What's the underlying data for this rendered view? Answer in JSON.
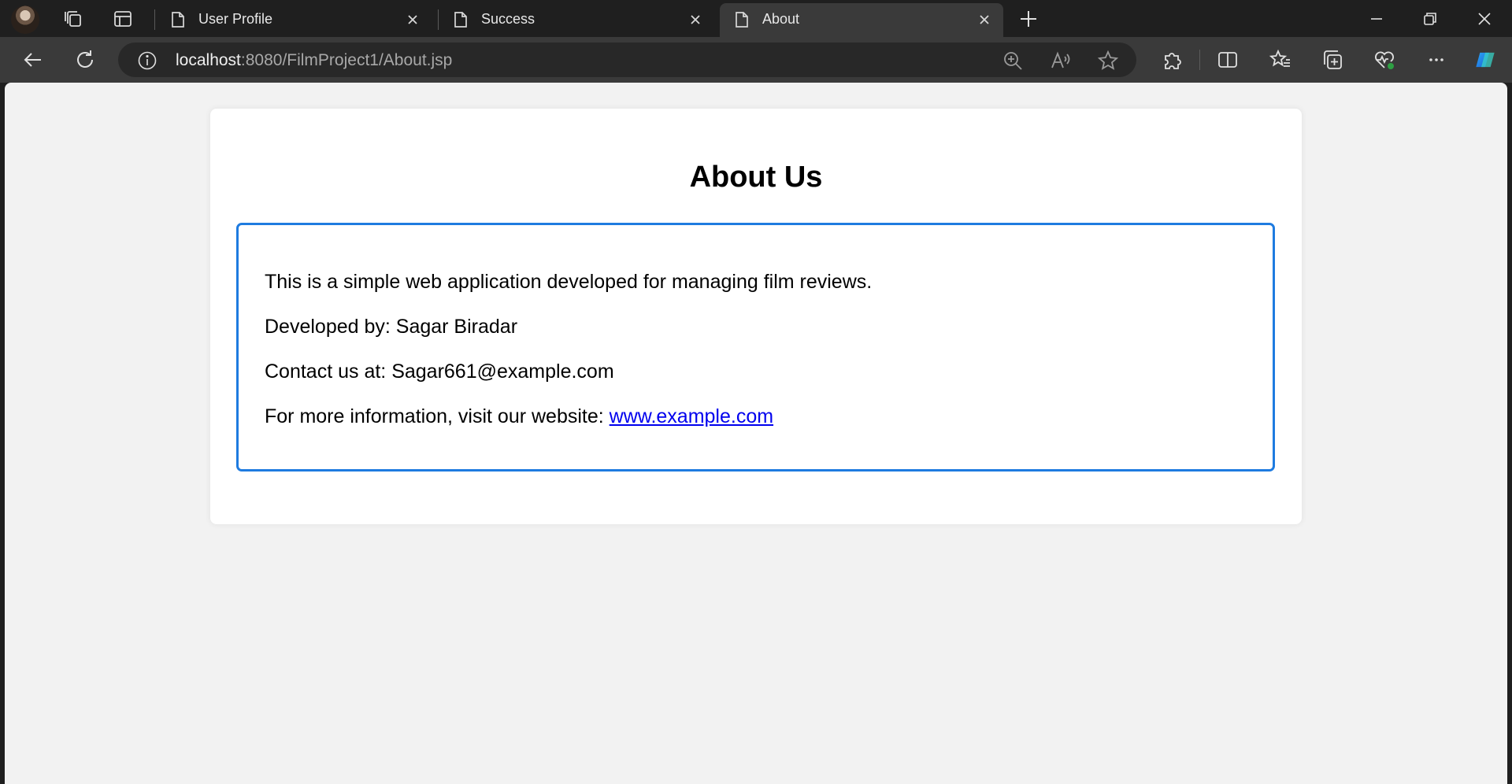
{
  "browser": {
    "tabs": [
      {
        "title": "User Profile",
        "active": false
      },
      {
        "title": "Success",
        "active": false
      },
      {
        "title": "About",
        "active": true
      }
    ],
    "address": {
      "host": "localhost",
      "rest": ":8080/FilmProject1/About.jsp"
    },
    "icons": {
      "profile": "profile-avatar",
      "workspaces": "workspaces-icon",
      "vertical_tabs": "tab-actions-icon",
      "new_tab": "plus-icon",
      "back": "back-arrow-icon",
      "refresh": "refresh-icon",
      "site_info": "info-icon",
      "zoom": "zoom-in-icon",
      "read_aloud": "read-aloud-icon",
      "favorite": "star-icon",
      "extensions": "puzzle-icon",
      "split_screen": "split-screen-icon",
      "favorites": "favorites-icon",
      "collections": "collections-icon",
      "browser_essentials": "heartbeat-icon",
      "more": "more-icon",
      "copilot": "copilot-icon"
    }
  },
  "page": {
    "heading": "About Us",
    "description": "This is a simple web application developed for managing film reviews.",
    "developer_text": "Developed by: Sagar Biradar",
    "contact_text": "Contact us at: Sagar661@example.com",
    "website_prefix": "For more information, visit our website: ",
    "website_link": "www.example.com"
  },
  "colors": {
    "page_background": "#f2f2f2",
    "card_background": "#ffffff",
    "box_border": "#1e7be0",
    "link": "#0000ee",
    "chrome_dark": "#1f1f1f",
    "chrome_toolbar": "#3a3a3a"
  }
}
